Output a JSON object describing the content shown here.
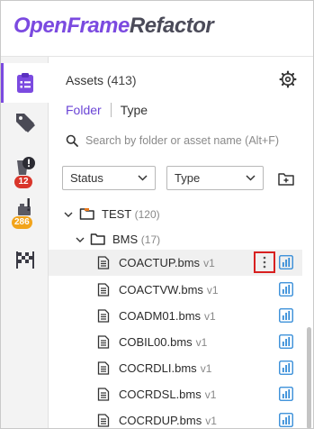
{
  "app": {
    "logo_part1": "OpenFrame",
    "logo_part2": "Refactor"
  },
  "rail": {
    "items": [
      {
        "name": "assets",
        "icon": "clipboard-list-icon",
        "active": true
      },
      {
        "name": "tags",
        "icon": "tag-icon",
        "active": false
      },
      {
        "name": "issues",
        "icon": "bucket-alert-icon",
        "badge": "12",
        "badge_color": "#d9362b"
      },
      {
        "name": "warnings",
        "icon": "box-alert-icon",
        "badge": "286",
        "badge_color": "#f2a41b"
      },
      {
        "name": "milestones",
        "icon": "checkered-flag-icon",
        "active": false
      }
    ]
  },
  "panel": {
    "title": "Assets",
    "count": "(413)",
    "tabs": {
      "folder": "Folder",
      "type": "Type"
    },
    "search_placeholder": "Search by folder or asset name (Alt+F)",
    "filters": {
      "status": "Status",
      "type": "Type"
    }
  },
  "tree": {
    "root": {
      "name": "TEST",
      "count": "(120)"
    },
    "child": {
      "name": "BMS",
      "count": "(17)"
    },
    "files": [
      {
        "name": "COACTUP.bms",
        "version": "v1"
      },
      {
        "name": "COACTVW.bms",
        "version": "v1"
      },
      {
        "name": "COADM01.bms",
        "version": "v1"
      },
      {
        "name": "COBIL00.bms",
        "version": "v1"
      },
      {
        "name": "COCRDLI.bms",
        "version": "v1"
      },
      {
        "name": "COCRDSL.bms",
        "version": "v1"
      },
      {
        "name": "COCRDUP.bms",
        "version": "v1"
      }
    ]
  },
  "colors": {
    "accent": "#7b4ae0",
    "folder_tab": "#6b45d6",
    "folder_icon_accent": "#e8791d",
    "chart_icon": "#2a86d6",
    "highlight_border": "#d82020"
  }
}
